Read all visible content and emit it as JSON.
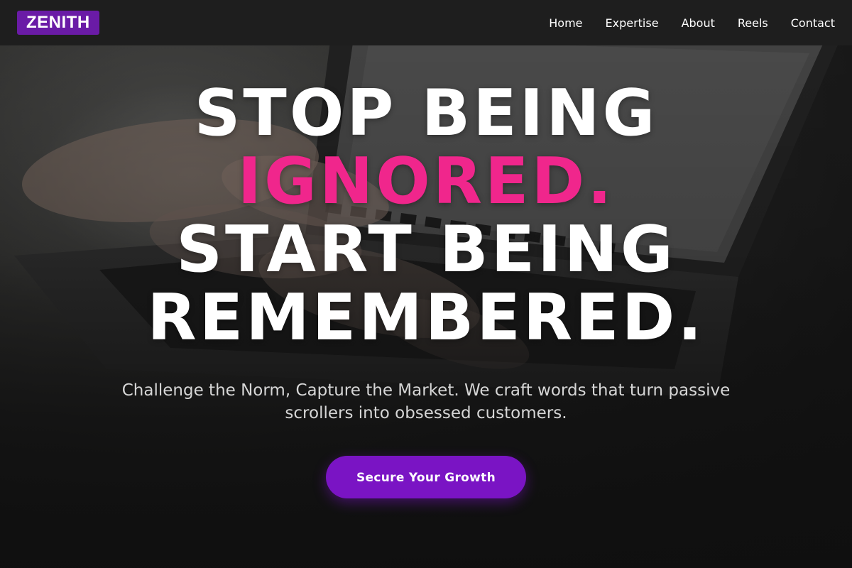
{
  "brand": {
    "logo_text": "ZENITH",
    "logo_color": "#6a1ba6"
  },
  "nav": {
    "items": [
      {
        "label": "Home"
      },
      {
        "label": "Expertise"
      },
      {
        "label": "About"
      },
      {
        "label": "Reels"
      },
      {
        "label": "Contact"
      }
    ]
  },
  "hero": {
    "headline_line1": "STOP BEING",
    "headline_accent": "IGNORED.",
    "headline_line3": "START BEING",
    "headline_line4": "REMEMBERED.",
    "accent_color": "#f0268c",
    "subheadline": "Challenge the Norm, Capture the Market. We craft words that turn passive scrollers into obsessed customers.",
    "cta_label": "Secure Your Growth",
    "cta_color": "#7a14c4",
    "background_image": "laptop-typing-photo"
  }
}
